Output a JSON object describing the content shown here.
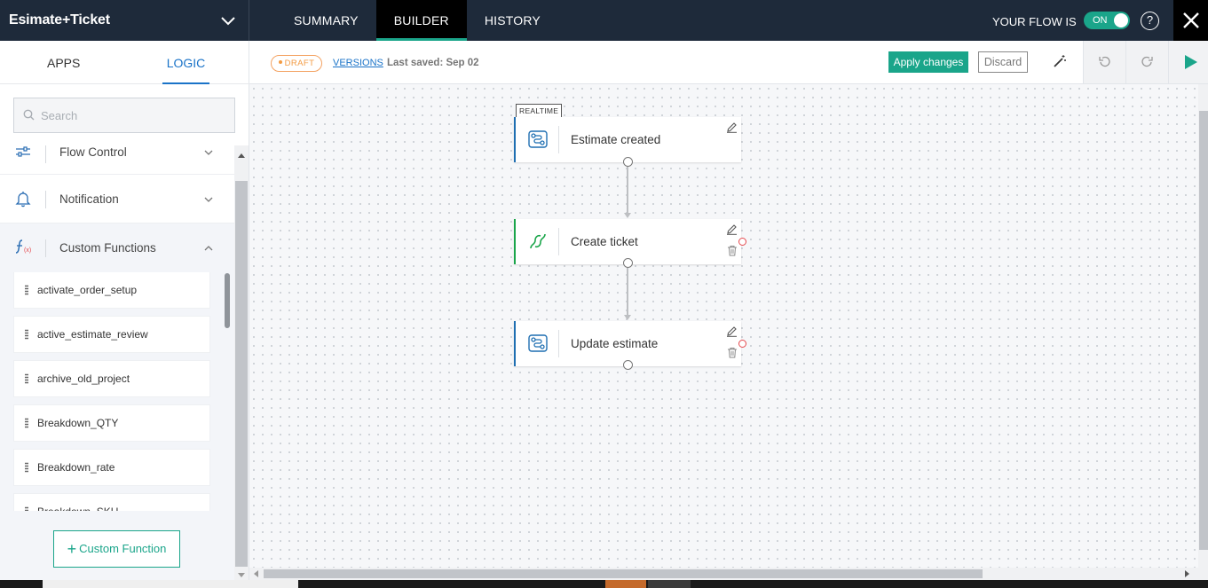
{
  "header": {
    "flow_name": "Esimate+Ticket",
    "tabs": [
      {
        "label": "SUMMARY"
      },
      {
        "label": "BUILDER"
      },
      {
        "label": "HISTORY"
      }
    ],
    "flow_state_label": "YOUR FLOW IS",
    "toggle_label": "ON",
    "help_label": "?"
  },
  "sidebar": {
    "tabs": [
      {
        "label": "APPS"
      },
      {
        "label": "LOGIC"
      }
    ],
    "search_placeholder": "Search",
    "categories": [
      {
        "label": "Flow Control"
      },
      {
        "label": "Notification"
      },
      {
        "label": "Custom Functions"
      }
    ],
    "functions": [
      {
        "label": "activate_order_setup"
      },
      {
        "label": "active_estimate_review"
      },
      {
        "label": "archive_old_project"
      },
      {
        "label": "Breakdown_QTY"
      },
      {
        "label": "Breakdown_rate"
      },
      {
        "label": "Breakdown_SKU"
      }
    ],
    "add_function_label": "Custom Function"
  },
  "toolbar": {
    "status_badge": "DRAFT",
    "versions_link": "VERSIONS",
    "last_saved": "Last saved: Sep 02",
    "apply_label": "Apply changes",
    "discard_label": "Discard"
  },
  "canvas": {
    "trigger_tag": "REALTIME",
    "nodes": [
      {
        "label": "Estimate created"
      },
      {
        "label": "Create ticket"
      },
      {
        "label": "Update estimate"
      }
    ]
  },
  "colors": {
    "accent": "#1aa58a",
    "link": "#1a73c8",
    "draft": "#f39b43",
    "header_bg": "#1e2a3a",
    "node_blue": "#1f6fb2",
    "node_green": "#1aa54a"
  }
}
